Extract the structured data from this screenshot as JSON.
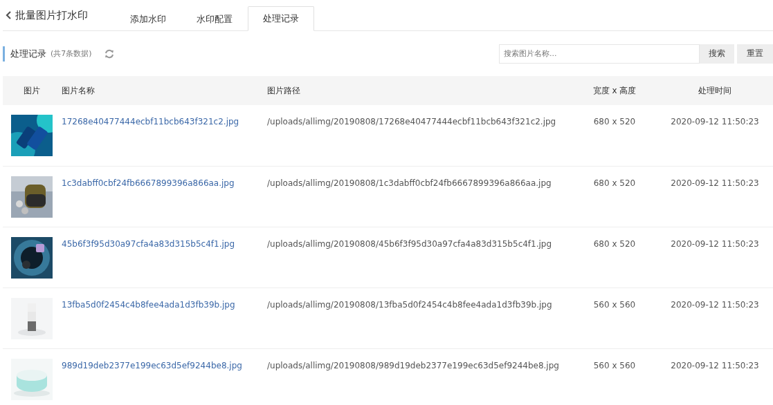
{
  "header": {
    "back_title": "批量图片打水印"
  },
  "tabs": [
    {
      "label": "添加水印",
      "selected": false
    },
    {
      "label": "水印配置",
      "selected": false
    },
    {
      "label": "处理记录",
      "selected": true
    }
  ],
  "section": {
    "title": "处理记录",
    "count": "(共7条数据)"
  },
  "search": {
    "placeholder": "搜索图片名称...",
    "search_button": "搜索",
    "reset_button": "重置"
  },
  "table": {
    "columns": [
      "图片",
      "图片名称",
      "图片路径",
      "宽度 x 高度",
      "处理时间"
    ],
    "rows": [
      {
        "name": "17268e40477444ecbf11bcb643f321c2.jpg",
        "path": "/uploads/allimg/20190808/17268e40477444ecbf11bcb643f321c2.jpg",
        "size": "680 x 520",
        "time": "2020-09-12 11:50:23"
      },
      {
        "name": "1c3dabff0cbf24fb6667899396a866aa.jpg",
        "path": "/uploads/allimg/20190808/1c3dabff0cbf24fb6667899396a866aa.jpg",
        "size": "680 x 520",
        "time": "2020-09-12 11:50:23"
      },
      {
        "name": "45b6f3f95d30a97cfa4a83d315b5c4f1.jpg",
        "path": "/uploads/allimg/20190808/45b6f3f95d30a97cfa4a83d315b5c4f1.jpg",
        "size": "680 x 520",
        "time": "2020-09-12 11:50:23"
      },
      {
        "name": "13fba5d0f2454c4b8fee4ada1d3fb39b.jpg",
        "path": "/uploads/allimg/20190808/13fba5d0f2454c4b8fee4ada1d3fb39b.jpg",
        "size": "560 x 560",
        "time": "2020-09-12 11:50:23"
      },
      {
        "name": "989d19deb2377e199ec63d5ef9244be8.jpg",
        "path": "/uploads/allimg/20190808/989d19deb2377e199ec63d5ef9244be8.jpg",
        "size": "560 x 560",
        "time": "2020-09-12 11:50:23"
      }
    ]
  }
}
